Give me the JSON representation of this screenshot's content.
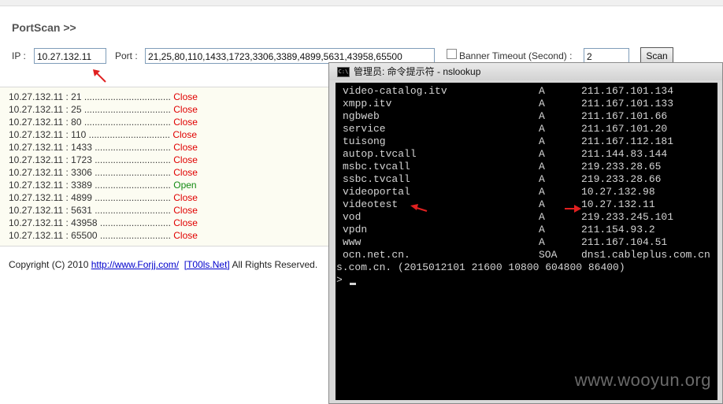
{
  "page": {
    "title": "PortScan >>",
    "ip_label": "IP :",
    "ip_value": "10.27.132.11",
    "port_label": "Port :",
    "port_value": "21,25,80,110,1433,1723,3306,3389,4899,5631,43958,65500",
    "banner_timeout_label": "Banner Timeout (Second) :",
    "banner_timeout_value": "2",
    "scan_button": "Scan"
  },
  "results": [
    {
      "host": "10.27.132.11 : 21",
      "dots": " .................................",
      "status": "Close"
    },
    {
      "host": "10.27.132.11 : 25",
      "dots": " .................................",
      "status": "Close"
    },
    {
      "host": "10.27.132.11 : 80",
      "dots": " .................................",
      "status": "Close"
    },
    {
      "host": "10.27.132.11 : 110",
      "dots": " ...............................",
      "status": "Close"
    },
    {
      "host": "10.27.132.11 : 1433",
      "dots": " .............................",
      "status": "Close"
    },
    {
      "host": "10.27.132.11 : 1723",
      "dots": " .............................",
      "status": "Close"
    },
    {
      "host": "10.27.132.11 : 3306",
      "dots": " .............................",
      "status": "Close"
    },
    {
      "host": "10.27.132.11 : 3389",
      "dots": " .............................",
      "status": "Open"
    },
    {
      "host": "10.27.132.11 : 4899",
      "dots": " .............................",
      "status": "Close"
    },
    {
      "host": "10.27.132.11 : 5631",
      "dots": " .............................",
      "status": "Close"
    },
    {
      "host": "10.27.132.11 : 43958",
      "dots": " ...........................",
      "status": "Close"
    },
    {
      "host": "10.27.132.11 : 65500",
      "dots": " ...........................",
      "status": "Close"
    }
  ],
  "footer": {
    "copyright": "Copyright (C) 2010 ",
    "link1": "http://www.Forjj.com/",
    "link2": "[T00ls.Net]",
    "rights": " All Rights Reserved."
  },
  "cmd_window": {
    "title": "管理员: 命令提示符 - nslookup",
    "icon": "cmd-icon",
    "records": [
      {
        "name": "video-catalog.itv",
        "type": "A",
        "value": "211.167.101.134"
      },
      {
        "name": "xmpp.itv",
        "type": "A",
        "value": "211.167.101.133"
      },
      {
        "name": "ngbweb",
        "type": "A",
        "value": "211.167.101.66"
      },
      {
        "name": "service",
        "type": "A",
        "value": "211.167.101.20"
      },
      {
        "name": "tuisong",
        "type": "A",
        "value": "211.167.112.181"
      },
      {
        "name": "autop.tvcall",
        "type": "A",
        "value": "211.144.83.144"
      },
      {
        "name": "msbc.tvcall",
        "type": "A",
        "value": "219.233.28.65"
      },
      {
        "name": "ssbc.tvcall",
        "type": "A",
        "value": "219.233.28.66"
      },
      {
        "name": "videoportal",
        "type": "A",
        "value": "10.27.132.98"
      },
      {
        "name": "videotest",
        "type": "A",
        "value": "10.27.132.11"
      },
      {
        "name": "vod",
        "type": "A",
        "value": "219.233.245.101"
      },
      {
        "name": "vpdn",
        "type": "A",
        "value": "211.154.93.2"
      },
      {
        "name": "www",
        "type": "A",
        "value": "211.167.104.51"
      },
      {
        "name": "ocn.net.cn.",
        "type": "SOA",
        "value": "dns1.cableplus.com.cn r"
      }
    ],
    "soa_continuation": "s.com.cn. (2015012101 21600 10800 604800 86400)",
    "prompt": ">"
  },
  "watermark": "www.wooyun.org",
  "colors": {
    "close": "#e00000",
    "open": "#138a13",
    "arrow": "#e02020",
    "console_bg": "#000000",
    "console_text": "#d4d4d4"
  }
}
